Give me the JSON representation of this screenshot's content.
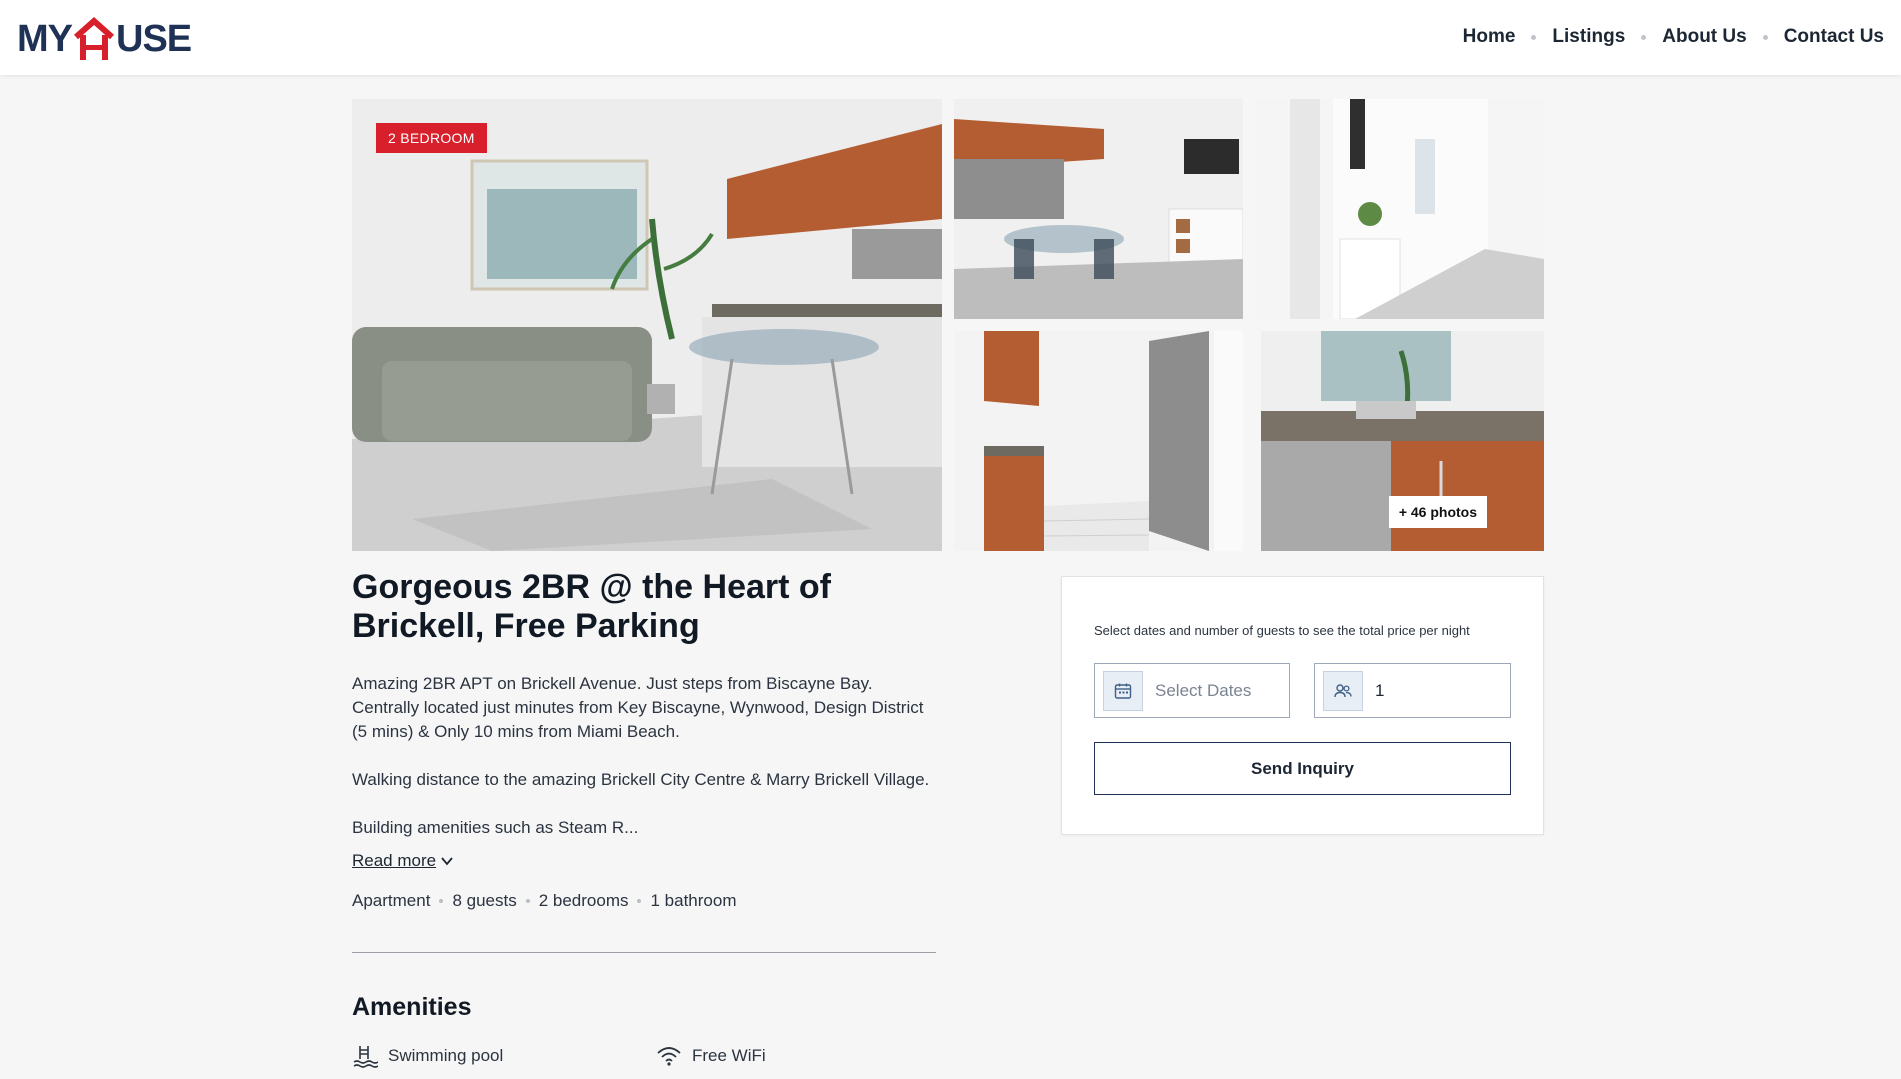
{
  "brand": {
    "logo_left": "MY",
    "logo_right": "USE",
    "accent_color": "#d7202b",
    "primary_color": "#1f3154"
  },
  "nav": {
    "items": [
      "Home",
      "Listings",
      "About Us",
      "Contact Us"
    ]
  },
  "gallery": {
    "badge": "2 BEDROOM",
    "photos_count": "+ 46 photos"
  },
  "listing": {
    "title": "Gorgeous 2BR @ the Heart of Brickell, Free Parking",
    "description": [
      "Amazing 2BR APT on Brickell Avenue. Just steps from Biscayne Bay. Centrally located just minutes from Key Biscayne, Wynwood, Design District (5 mins) & Only 10 mins from Miami Beach.",
      "Walking distance to the amazing Brickell City Centre & Marry Brickell Village.",
      "Building amenities such as Steam R..."
    ],
    "read_more": "Read more",
    "specs": [
      "Apartment",
      "8 guests",
      "2 bedrooms",
      "1 bathroom"
    ]
  },
  "amenities": {
    "title": "Amenities",
    "items": [
      {
        "label": "Swimming pool",
        "icon": "pool-icon"
      },
      {
        "label": "Free WiFi",
        "icon": "wifi-icon"
      }
    ]
  },
  "booking": {
    "hint": "Select dates and number of guests to see the total price per night",
    "dates_placeholder": "Select Dates",
    "guests_value": "1",
    "send_label": "Send Inquiry"
  }
}
